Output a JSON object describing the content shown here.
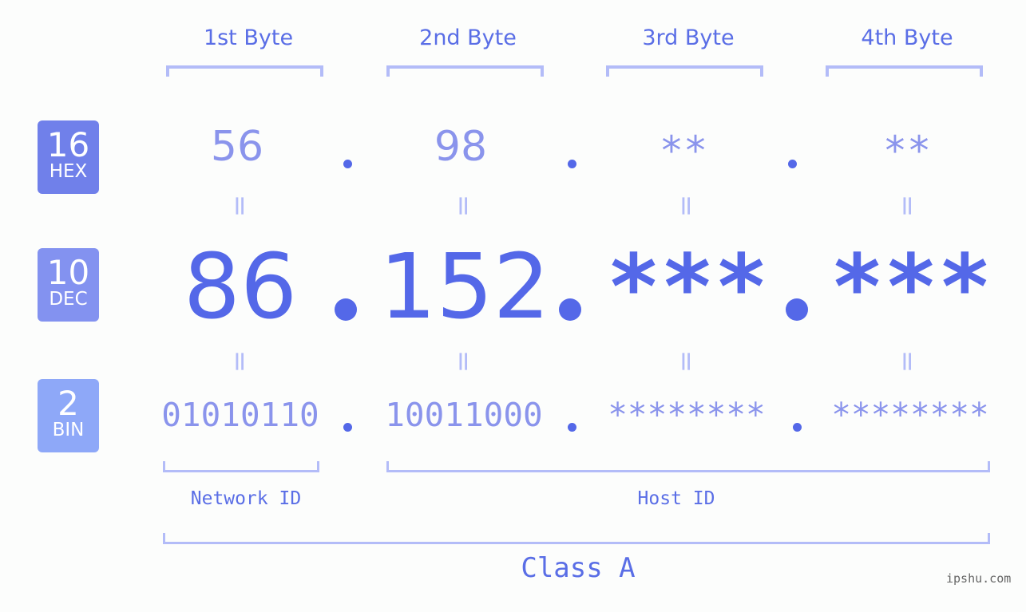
{
  "headers": [
    "1st Byte",
    "2nd Byte",
    "3rd Byte",
    "4th Byte"
  ],
  "badges": {
    "hex": {
      "num": "16",
      "label": "HEX",
      "color": "#7080ea"
    },
    "dec": {
      "num": "10",
      "label": "DEC",
      "color": "#8392f0"
    },
    "bin": {
      "num": "2",
      "label": "BIN",
      "color": "#8ea8f8"
    }
  },
  "hex": [
    "56",
    "98",
    "**",
    "**"
  ],
  "dec": [
    "86",
    "152",
    "***",
    "***"
  ],
  "bin": [
    "01010110",
    "10011000",
    "********",
    "********"
  ],
  "equals": "=",
  "network_id": "Network ID",
  "host_id": "Host ID",
  "class": "Class A",
  "watermark": "ipshu.com",
  "colors": {
    "primary": "#5468e8",
    "light": "#8a94ec",
    "bracket": "#b3bcf8"
  }
}
